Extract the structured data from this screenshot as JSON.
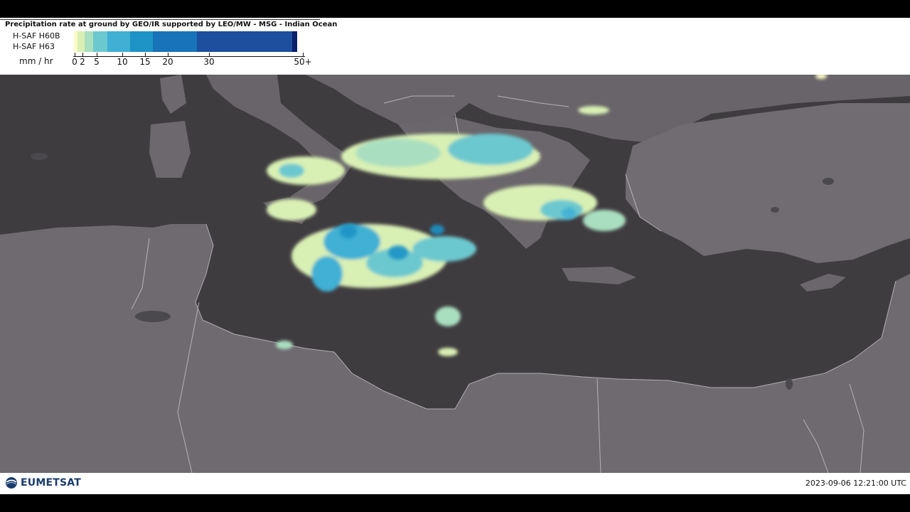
{
  "header": {
    "title": "Precipitation rate at ground by GEO/IR supported by LEO/MW - MSG - Indian Ocean",
    "products": [
      "H-SAF H60B",
      "H-SAF H63"
    ],
    "units": "mm / hr",
    "scale_labels": [
      "0",
      "2",
      "5",
      "10",
      "15",
      "20",
      "30",
      "50+"
    ],
    "scale_colors": [
      "#fbfbc6",
      "#d9f0b4",
      "#a9dfc0",
      "#6cc8cf",
      "#3fb0d4",
      "#1d93c6",
      "#1873b8",
      "#1c4f9e",
      "#0b1f6a"
    ]
  },
  "footer": {
    "logo": "EUMETSAT",
    "timestamp": "2023-09-06 12:21:00 UTC"
  },
  "map": {
    "region": "Eastern Mediterranean",
    "sea_color": "#3e3b3f",
    "land_color": "#6e6a70",
    "precip_colors": [
      "#fbfbc6",
      "#d9f0b4",
      "#a9dfc0",
      "#6cc8cf",
      "#3fb0d4",
      "#1d93c6"
    ]
  }
}
